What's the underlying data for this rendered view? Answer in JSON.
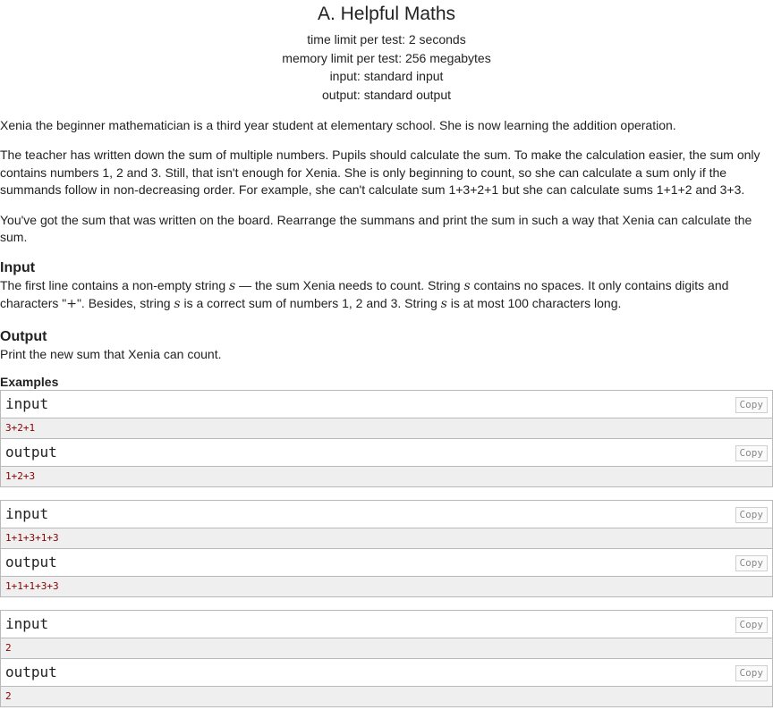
{
  "problem": {
    "title": "A. Helpful Maths",
    "time_limit": "time limit per test: 2 seconds",
    "memory_limit": "memory limit per test: 256 megabytes",
    "input": "input: standard input",
    "output": "output: standard output"
  },
  "statement": {
    "p1": "Xenia the beginner mathematician is a third year student at elementary school. She is now learning the addition operation.",
    "p2": "The teacher has written down the sum of multiple numbers. Pupils should calculate the sum. To make the calculation easier, the sum only contains numbers 1, 2 and 3. Still, that isn't enough for Xenia. She is only beginning to count, so she can calculate a sum only if the summands follow in non-decreasing order. For example, she can't calculate sum 1+3+2+1 but she can calculate sums 1+1+2 and 3+3.",
    "p3": "You've got the sum that was written on the board. Rearrange the summans and print the sum in such a way that Xenia can calculate the sum."
  },
  "input_section": {
    "title": "Input",
    "t1": "The first line contains a non-empty string ",
    "var": "s",
    "t2": " — the sum Xenia needs to count. String ",
    "t3": " contains no spaces. It only contains digits and characters \"",
    "plus": "+",
    "t4": "\". Besides, string ",
    "t5": " is a correct sum of numbers 1, 2 and 3. String ",
    "t6": " is at most 100 characters long."
  },
  "output_section": {
    "title": "Output",
    "text": "Print the new sum that Xenia can count."
  },
  "examples": {
    "title": "Examples",
    "input_label": "input",
    "output_label": "output",
    "copy_label": "Copy",
    "tests": [
      {
        "input": "3+2+1",
        "output": "1+2+3"
      },
      {
        "input": "1+1+3+1+3",
        "output": "1+1+1+3+3"
      },
      {
        "input": "2",
        "output": "2"
      }
    ]
  }
}
